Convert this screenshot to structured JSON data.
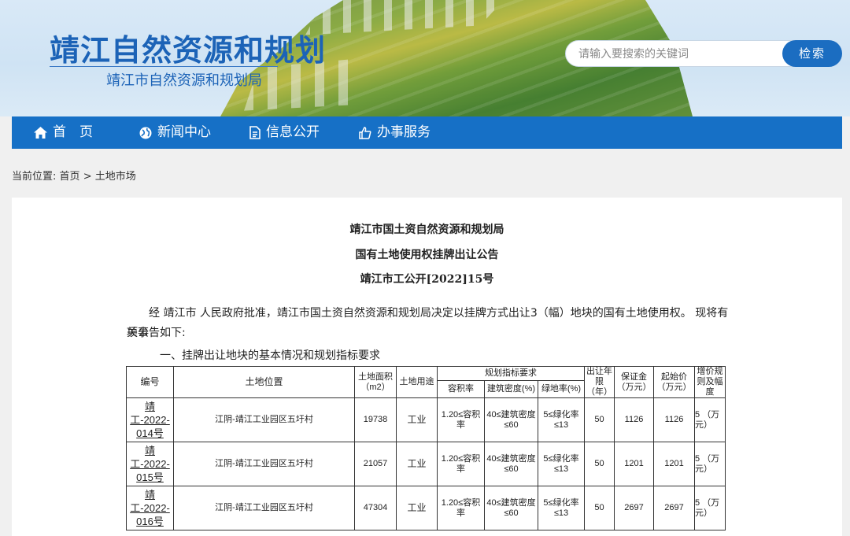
{
  "header": {
    "title": "靖江自然资源和规划",
    "subtitle": "靖江市自然资源和规划局",
    "search_placeholder": "请输入要搜索的关键词",
    "search_button": "检索"
  },
  "nav": {
    "items": [
      {
        "label": "首　页",
        "icon": "home-icon"
      },
      {
        "label": "新闻中心",
        "icon": "globe-icon"
      },
      {
        "label": "信息公开",
        "icon": "document-icon"
      },
      {
        "label": "办事服务",
        "icon": "thumbs-up-icon"
      }
    ]
  },
  "breadcrumb": {
    "prefix": "当前位置:",
    "home": "首页",
    "sep": ">",
    "current": "土地市场"
  },
  "article": {
    "line1": "靖江市国土资自然资源和规划局",
    "line2": "国有土地使用权挂牌出让公告",
    "line3": "靖江市工公开[2022]15号",
    "para1_a": "经 靖江市 人民政府批准，靖江市国土资自然资源和规划局决定以挂牌方式出让3（幅）地块的国有土地使用权。 现将有关事",
    "para1_b": "项公告如下:",
    "section1": "一、挂牌出让地块的基本情况和规划指标要求"
  },
  "table": {
    "headers": {
      "code": "编号",
      "location": "土地位置",
      "area": "土地面积（m2）",
      "use": "土地用途",
      "planning": "规划指标要求",
      "far": "容积率",
      "density": "建筑密度(%)",
      "green": "绿地率(%)",
      "term": "出让年限（年）",
      "deposit": "保证金（万元）",
      "start_price": "起始价（万元）",
      "increment": "增价规则及幅度"
    },
    "rows": [
      {
        "code_a": "靖",
        "code_b": "工-2022-",
        "code_c": "014号",
        "location": "江阴-靖江工业园区五圩村",
        "area": "19738",
        "use": "工业",
        "far": "1.20≤容积率",
        "density": "40≤建筑密度≤60",
        "green": "5≤绿化率≤13",
        "term": "50",
        "deposit": "1126",
        "start_price": "1126",
        "increment": "5 （万元）"
      },
      {
        "code_a": "靖",
        "code_b": "工-2022-",
        "code_c": "015号",
        "location": "江阴-靖江工业园区五圩村",
        "area": "21057",
        "use": "工业",
        "far": "1.20≤容积率",
        "density": "40≤建筑密度≤60",
        "green": "5≤绿化率≤13",
        "term": "50",
        "deposit": "1201",
        "start_price": "1201",
        "increment": "5 （万元）"
      },
      {
        "code_a": "靖",
        "code_b": "工-2022-",
        "code_c": "016号",
        "location": "江阴-靖江工业园区五圩村",
        "area": "47304",
        "use": "工业",
        "far": "1.20≤容积率",
        "density": "40≤建筑密度≤60",
        "green": "5≤绿化率≤13",
        "term": "50",
        "deposit": "2697",
        "start_price": "2697",
        "increment": "5 （万元）"
      }
    ]
  },
  "colors": {
    "brand_blue": "#1c63b7",
    "nav_blue": "#1670c6",
    "button_blue": "#1b6dc1"
  }
}
